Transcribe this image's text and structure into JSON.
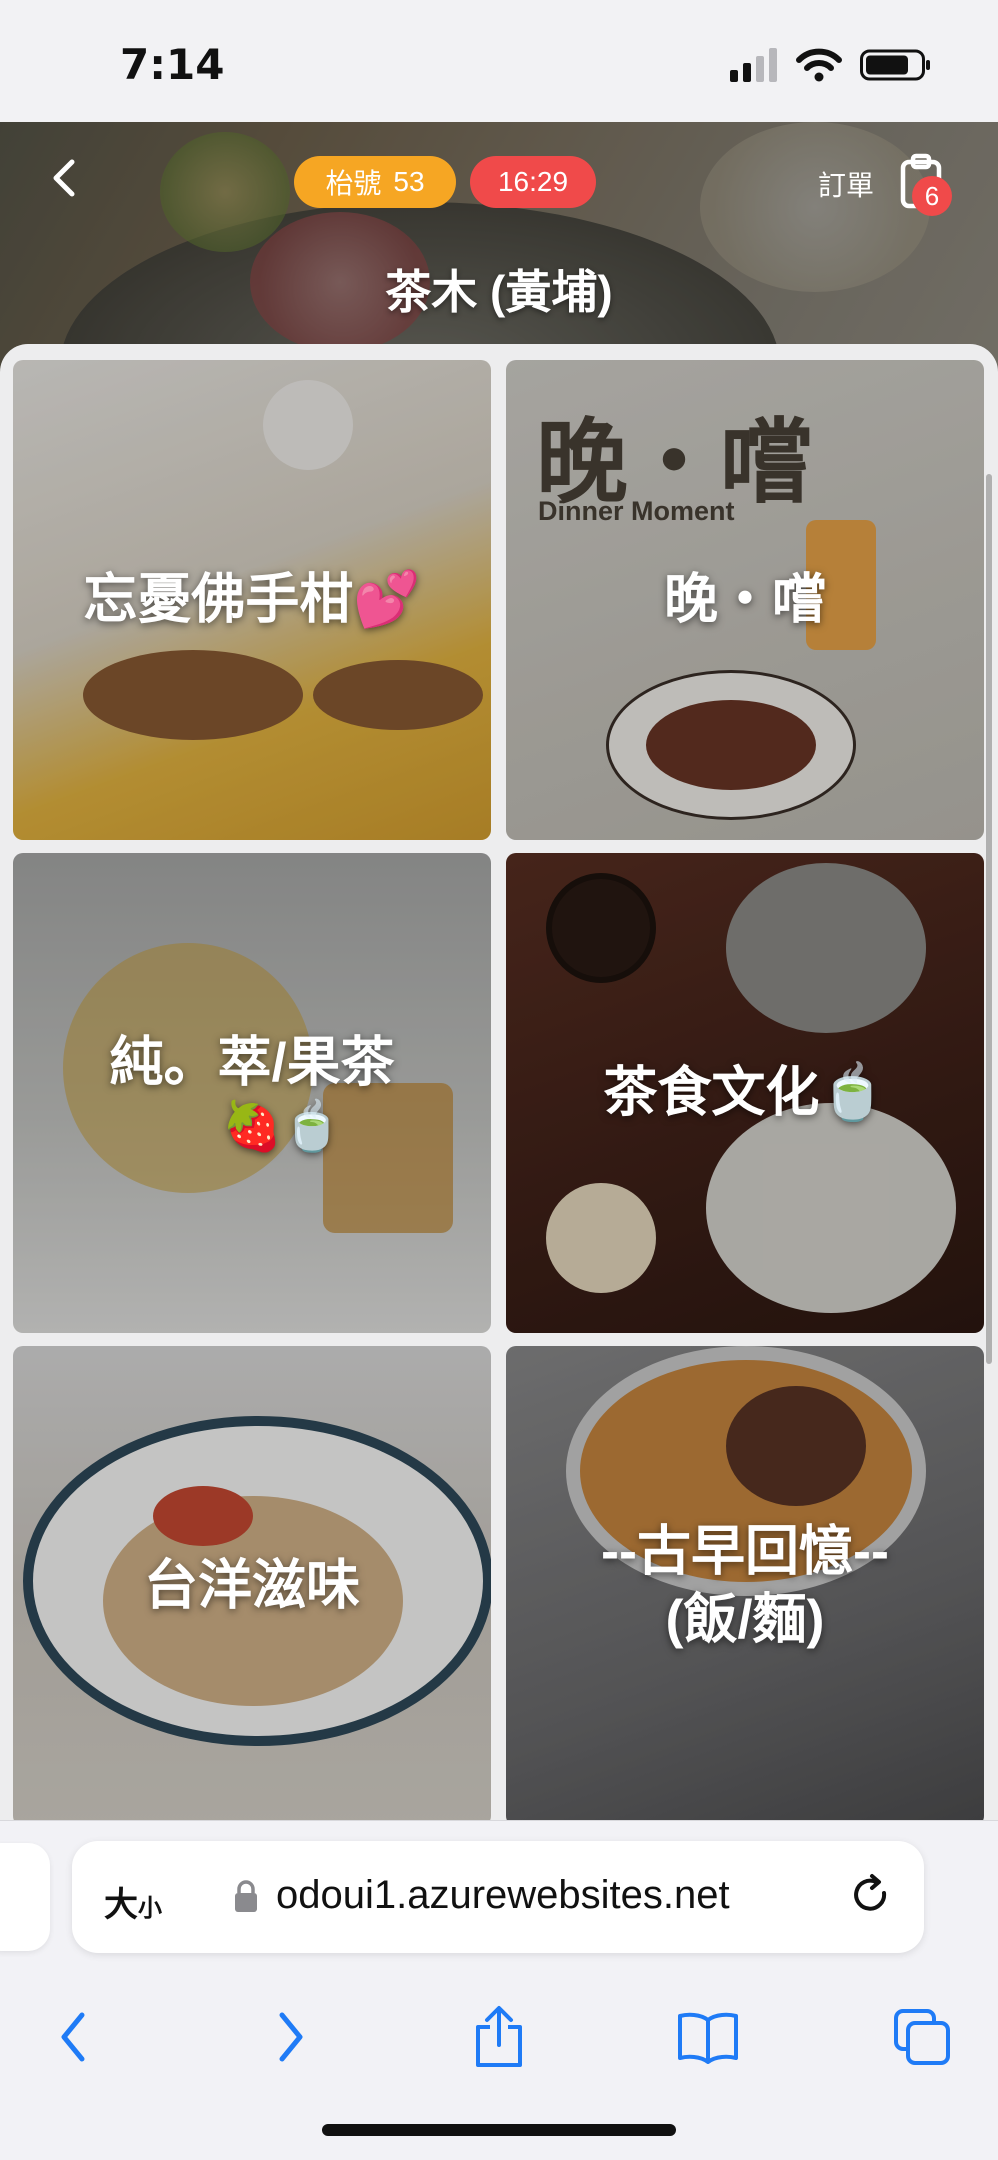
{
  "status_bar": {
    "time": "7:14"
  },
  "header": {
    "table_label": "枱號",
    "table_number": "53",
    "clock": "16:29",
    "order_label": "訂單",
    "order_count": "6",
    "store_name": "茶木 (黃埔)"
  },
  "categories": [
    {
      "title": "忘憂佛手柑💕"
    },
    {
      "title": "晚・嚐",
      "image_heading": "晚・嚐",
      "image_subheading": "Dinner Moment"
    },
    {
      "title_line1": "純。萃/果茶",
      "title_line2": "🍓🍵"
    },
    {
      "title": "茶食文化🍵"
    },
    {
      "title": "台洋滋味"
    },
    {
      "title_line1": "--古早回憶--",
      "title_line2": "(飯/麵)"
    }
  ],
  "browser": {
    "size_label_big": "大",
    "size_label_small": "小",
    "url": "odoui1.azurewebsites.net"
  },
  "colors": {
    "table_pill": "#f6a623",
    "time_pill": "#f04a4a",
    "badge": "#f04a4a",
    "ios_blue": "#1f7bf6"
  },
  "icons": [
    "back-icon",
    "clipboard-icon",
    "lock-icon",
    "reload-icon",
    "chevron-left-icon",
    "chevron-right-icon",
    "share-icon",
    "book-icon",
    "tabs-icon"
  ]
}
